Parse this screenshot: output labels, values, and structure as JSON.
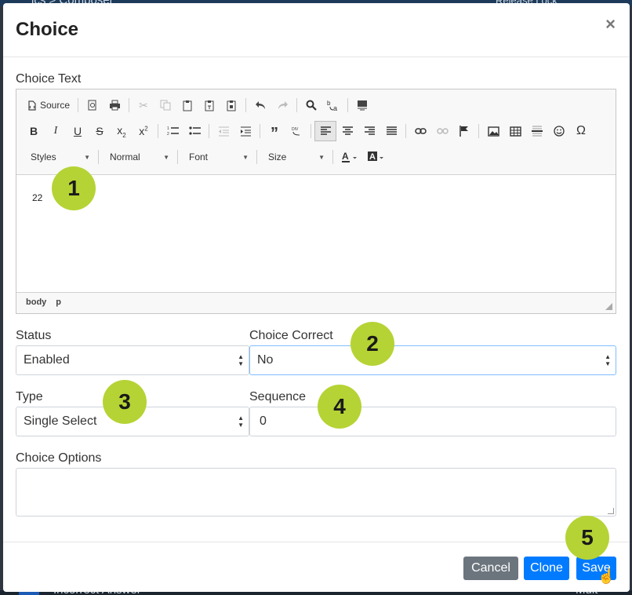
{
  "background": {
    "crumb": "ics > Composer",
    "lock": "Release Lock",
    "row_text": "Incorrect Answer",
    "row_end": "Mult"
  },
  "modal": {
    "title": "Choice",
    "close_glyph": "×"
  },
  "editor": {
    "label": "Choice Text",
    "source_label": "Source",
    "combos": {
      "styles": "Styles",
      "format": "Normal",
      "font": "Font",
      "size": "Size"
    },
    "content": "22",
    "path": [
      "body",
      "p"
    ]
  },
  "form": {
    "status": {
      "label": "Status",
      "value": "Enabled"
    },
    "choice_correct": {
      "label": "Choice Correct",
      "value": "No"
    },
    "type": {
      "label": "Type",
      "value": "Single Select"
    },
    "sequence": {
      "label": "Sequence",
      "value": "0"
    },
    "choice_options": {
      "label": "Choice Options",
      "value": ""
    }
  },
  "footer": {
    "cancel": "Cancel",
    "clone": "Clone",
    "save": "Save"
  },
  "markers": [
    "1",
    "2",
    "3",
    "4",
    "5"
  ],
  "colors": {
    "primary": "#007bff",
    "secondary": "#6c757d",
    "marker": "#b5d334"
  }
}
